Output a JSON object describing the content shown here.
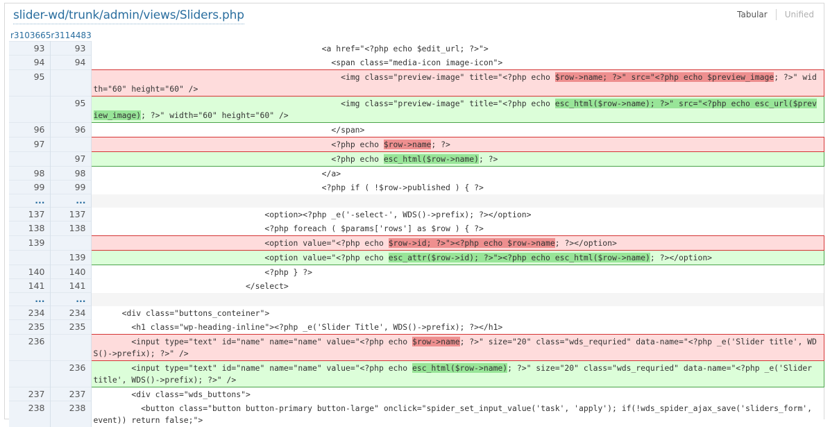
{
  "header": {
    "file_path": "slider-wd/trunk/admin/views/Sliders.php",
    "view_tabular": "Tabular",
    "view_unified": "Unified",
    "rev_old": "r3103665",
    "rev_new": "r3114483"
  },
  "colors": {
    "link": "#2a6e9f",
    "deleted_bg": "#fedcdc",
    "deleted_border": "#d43434",
    "deleted_highlight": "#ee8f8f",
    "added_bg": "#dcfed9",
    "added_border": "#4aa34a",
    "added_highlight": "#98e598",
    "line_number_bg": "#eef3f9"
  },
  "rows": [
    {
      "type": "ctx",
      "old": "93",
      "new": "93",
      "segments": [
        {
          "t": "                                                <a href=\"<?php echo $edit_url; ?>\">"
        }
      ]
    },
    {
      "type": "ctx",
      "old": "94",
      "new": "94",
      "segments": [
        {
          "t": "                                                  <span class=\"media-icon image-icon\">"
        }
      ]
    },
    {
      "type": "del",
      "old": "95",
      "new": "",
      "segments": [
        {
          "t": "                                                    <img class=\"preview-image\" title=\"<?php echo "
        },
        {
          "t": "$row->name; ?>\" src=\"<?php echo $preview_image",
          "h": true
        },
        {
          "t": "; ?>\" width=\"60\" height=\"60\" />"
        }
      ]
    },
    {
      "type": "add",
      "old": "",
      "new": "95",
      "segments": [
        {
          "t": "                                                    <img class=\"preview-image\" title=\"<?php echo "
        },
        {
          "t": "esc_html($row->name); ?>\" src=\"<?php echo esc_url($preview_image)",
          "h": true
        },
        {
          "t": "; ?>\" width=\"60\" height=\"60\" />"
        }
      ]
    },
    {
      "type": "ctx",
      "old": "96",
      "new": "96",
      "segments": [
        {
          "t": "                                                  </span>"
        }
      ]
    },
    {
      "type": "del",
      "old": "97",
      "new": "",
      "segments": [
        {
          "t": "                                                  <?php echo "
        },
        {
          "t": "$row->name",
          "h": true
        },
        {
          "t": "; ?>"
        }
      ]
    },
    {
      "type": "add",
      "old": "",
      "new": "97",
      "segments": [
        {
          "t": "                                                  <?php echo "
        },
        {
          "t": "esc_html($row->name)",
          "h": true
        },
        {
          "t": "; ?>"
        }
      ]
    },
    {
      "type": "ctx",
      "old": "98",
      "new": "98",
      "segments": [
        {
          "t": "                                                </a>"
        }
      ]
    },
    {
      "type": "ctx",
      "old": "99",
      "new": "99",
      "segments": [
        {
          "t": "                                                <?php if ( !$row->published ) { ?>"
        }
      ]
    },
    {
      "type": "skip",
      "old": "...",
      "new": "...",
      "segments": [
        {
          "t": ""
        }
      ]
    },
    {
      "type": "ctx",
      "old": "137",
      "new": "137",
      "segments": [
        {
          "t": "                                    <option><?php _e('-select-', WDS()->prefix); ?></option>"
        }
      ]
    },
    {
      "type": "ctx",
      "old": "138",
      "new": "138",
      "segments": [
        {
          "t": "                                    <?php foreach ( $params['rows'] as $row ) { ?>"
        }
      ]
    },
    {
      "type": "del",
      "old": "139",
      "new": "",
      "segments": [
        {
          "t": "                                    <option value=\"<?php echo "
        },
        {
          "t": "$row->id; ?>\"><?php echo $row->name",
          "h": true
        },
        {
          "t": "; ?></option>"
        }
      ]
    },
    {
      "type": "add",
      "old": "",
      "new": "139",
      "segments": [
        {
          "t": "                                    <option value=\"<?php echo "
        },
        {
          "t": "esc_attr($row->id); ?>\"><?php echo esc_html($row->name)",
          "h": true
        },
        {
          "t": "; ?></option>"
        }
      ]
    },
    {
      "type": "ctx",
      "old": "140",
      "new": "140",
      "segments": [
        {
          "t": "                                    <?php } ?>"
        }
      ]
    },
    {
      "type": "ctx",
      "old": "141",
      "new": "141",
      "segments": [
        {
          "t": "                                </select>"
        }
      ]
    },
    {
      "type": "skip",
      "old": "...",
      "new": "...",
      "segments": [
        {
          "t": ""
        }
      ]
    },
    {
      "type": "ctx",
      "old": "234",
      "new": "234",
      "segments": [
        {
          "t": "      <div class=\"buttons_conteiner\">"
        }
      ]
    },
    {
      "type": "ctx",
      "old": "235",
      "new": "235",
      "segments": [
        {
          "t": "        <h1 class=\"wp-heading-inline\"><?php _e('Slider Title', WDS()->prefix); ?></h1>"
        }
      ]
    },
    {
      "type": "del",
      "old": "236",
      "new": "",
      "segments": [
        {
          "t": "        <input type=\"text\" id=\"name\" name=\"name\" value=\"<?php echo "
        },
        {
          "t": "$row->name",
          "h": true
        },
        {
          "t": "; ?>\" size=\"20\" class=\"wds_requried\" data-name=\"<?php _e('Slider title', WDS()->prefix); ?>\" />"
        }
      ]
    },
    {
      "type": "add",
      "old": "",
      "new": "236",
      "segments": [
        {
          "t": "        <input type=\"text\" id=\"name\" name=\"name\" value=\"<?php echo "
        },
        {
          "t": "esc_html($row->name)",
          "h": true
        },
        {
          "t": "; ?>\" size=\"20\" class=\"wds_requried\" data-name=\"<?php _e('Slider title', WDS()->prefix); ?>\" />"
        }
      ]
    },
    {
      "type": "ctx",
      "old": "237",
      "new": "237",
      "segments": [
        {
          "t": "        <div class=\"wds_buttons\">"
        }
      ]
    },
    {
      "type": "ctx",
      "old": "238",
      "new": "238",
      "segments": [
        {
          "t": "          <button class=\"button button-primary button-large\" onclick=\"spider_set_input_value('task', 'apply'); if(!wds_spider_ajax_save('sliders_form', event)) return false;\">"
        }
      ]
    }
  ]
}
